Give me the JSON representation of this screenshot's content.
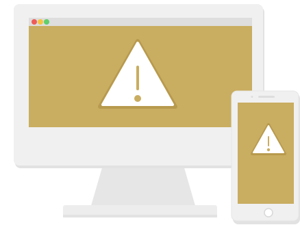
{
  "colors": {
    "background": "#ffffff",
    "device_frame": "#f0f0f0",
    "device_frame_shadow": "#e2e2e2",
    "titlebar": "#dedede",
    "screen": "#c9ad60",
    "warning_triangle": "#ffffff",
    "warning_triangle_outline": "#b89a4e",
    "warning_mark": "#c9ad60",
    "window_dot_close": "#ef5b57",
    "window_dot_minimize": "#f5c542",
    "window_dot_maximize": "#5fcf6b",
    "stand": "#e6e6e6",
    "stand_base": "#ededed"
  },
  "illustration": {
    "subject": "desktop-monitor-and-smartphone-error-illustration",
    "desktop_window": {
      "controls": [
        "close-dot",
        "minimize-dot",
        "maximize-dot"
      ],
      "icon": "warning-triangle-icon"
    },
    "phone": {
      "icon": "warning-triangle-icon"
    }
  }
}
